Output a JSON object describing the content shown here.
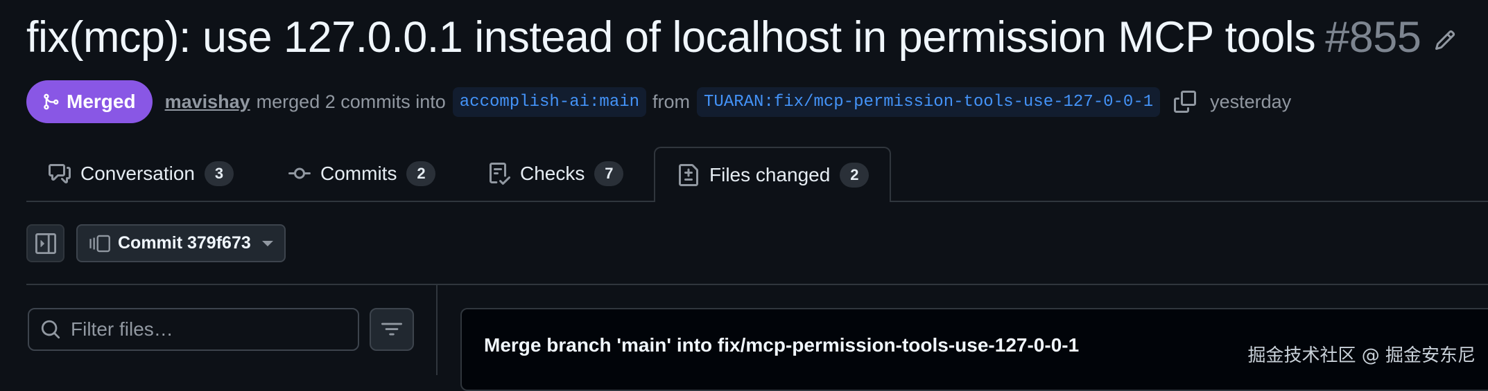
{
  "pr": {
    "title": "fix(mcp): use 127.0.0.1 instead of localhost in permission MCP tools",
    "number": "#855",
    "state_label": "Merged",
    "author": "mavishay",
    "merged_text": "merged 2 commits into",
    "base_branch": "accomplish-ai:main",
    "from_text": "from",
    "head_branch": "TUARAN:fix/mcp-permission-tools-use-127-0-0-1",
    "time": "yesterday"
  },
  "tabs": [
    {
      "label": "Conversation",
      "count": "3",
      "icon": "comment-discussion-icon"
    },
    {
      "label": "Commits",
      "count": "2",
      "icon": "git-commit-icon"
    },
    {
      "label": "Checks",
      "count": "7",
      "icon": "checklist-icon"
    },
    {
      "label": "Files changed",
      "count": "2",
      "icon": "file-diff-icon"
    }
  ],
  "toolbar": {
    "commit_label": "Commit 379f673"
  },
  "files": {
    "filter_placeholder": "Filter files…"
  },
  "commit": {
    "message": "Merge branch 'main' into fix/mcp-permission-tools-use-127-0-0-1"
  },
  "watermark": "掘金技术社区 @ 掘金安东尼",
  "colors": {
    "background": "#0d1117",
    "merged": "#8957e5",
    "branch_link": "#4493f8",
    "muted": "#9198a1",
    "border": "#30363d"
  }
}
